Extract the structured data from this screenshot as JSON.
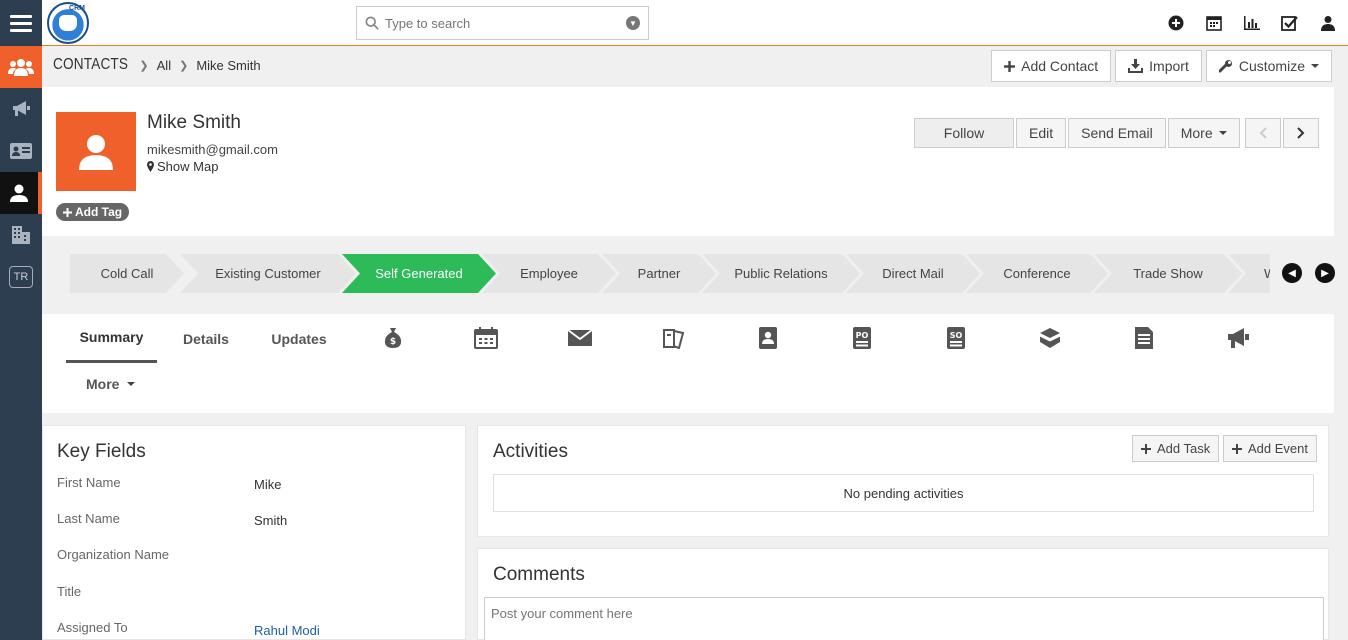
{
  "logo": {
    "text": "CRM"
  },
  "search": {
    "placeholder": "Type to search"
  },
  "breadcrumb": {
    "module": "CONTACTS",
    "filter": "All",
    "record": "Mike Smith"
  },
  "header_buttons": {
    "add_contact": "Add Contact",
    "import": "Import",
    "customize": "Customize"
  },
  "contact": {
    "name": "Mike Smith",
    "email": "mikesmith@gmail.com",
    "show_map": "Show Map",
    "add_tag": "Add Tag"
  },
  "actions": {
    "follow": "Follow",
    "edit": "Edit",
    "send_email": "Send Email",
    "more": "More"
  },
  "stages": {
    "active": "Self Generated",
    "items": [
      "Cold Call",
      "Existing Customer",
      "Self Generated",
      "Employee",
      "Partner",
      "Public Relations",
      "Direct Mail",
      "Conference",
      "Trade Show",
      "W"
    ]
  },
  "tabs": {
    "summary": "Summary",
    "details": "Details",
    "updates": "Updates",
    "more": "More",
    "icons": [
      "money-bag-icon",
      "calendar-icon",
      "envelope-icon",
      "tickets-icon",
      "contact-book-icon",
      "po-icon",
      "so-icon",
      "boxes-icon",
      "document-icon",
      "megaphone-icon"
    ]
  },
  "key_fields": {
    "title": "Key Fields",
    "rows": [
      {
        "label": "First Name",
        "value": "Mike"
      },
      {
        "label": "Last Name",
        "value": "Smith"
      },
      {
        "label": "Organization Name",
        "value": ""
      },
      {
        "label": "Title",
        "value": ""
      },
      {
        "label": "Assigned To",
        "value": "Rahul Modi"
      }
    ]
  },
  "activities": {
    "title": "Activities",
    "add_task": "Add Task",
    "add_event": "Add Event",
    "empty": "No pending activities"
  },
  "comments": {
    "title": "Comments",
    "placeholder": "Post your comment here"
  },
  "colors": {
    "accent": "#f0602a",
    "sidebar": "#2c3e50",
    "stage_active": "#2dbb5a",
    "link": "#1f5fa8"
  }
}
